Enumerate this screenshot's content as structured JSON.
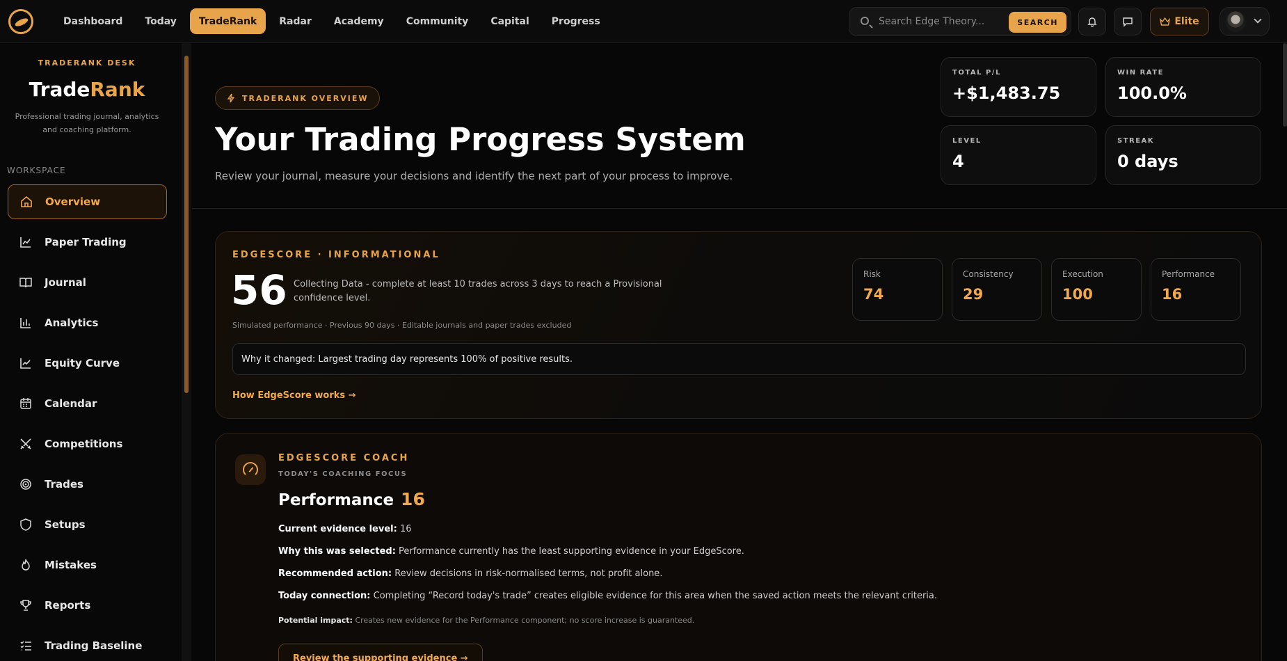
{
  "nav": {
    "items": [
      "Dashboard",
      "Today",
      "TradeRank",
      "Radar",
      "Academy",
      "Community",
      "Capital",
      "Progress"
    ],
    "active": "TradeRank"
  },
  "search": {
    "placeholder": "Search Edge Theory...",
    "button": "SEARCH"
  },
  "header": {
    "elite_label": "Elite"
  },
  "sidebar": {
    "desk_label": "TRADERANK DESK",
    "brand_a": "Trade",
    "brand_b": "Rank",
    "brand_sub": "Professional trading journal, analytics and coaching platform.",
    "workspace_label": "WORKSPACE",
    "items": [
      {
        "label": "Overview",
        "icon": "home-icon"
      },
      {
        "label": "Paper Trading",
        "icon": "chart-line-icon"
      },
      {
        "label": "Journal",
        "icon": "book-icon"
      },
      {
        "label": "Analytics",
        "icon": "bar-chart-icon"
      },
      {
        "label": "Equity Curve",
        "icon": "trend-icon"
      },
      {
        "label": "Calendar",
        "icon": "calendar-icon"
      },
      {
        "label": "Competitions",
        "icon": "swords-icon"
      },
      {
        "label": "Trades",
        "icon": "target-icon"
      },
      {
        "label": "Setups",
        "icon": "shield-icon"
      },
      {
        "label": "Mistakes",
        "icon": "flame-icon"
      },
      {
        "label": "Reports",
        "icon": "trophy-icon"
      },
      {
        "label": "Trading Baseline",
        "icon": "checklist-icon"
      }
    ]
  },
  "hero": {
    "pill": "TRADERANK OVERVIEW",
    "title": "Your Trading Progress System",
    "subtitle": "Review your journal, measure your decisions and identify the next part of your process to improve."
  },
  "stats": [
    {
      "label": "TOTAL P/L",
      "value": "+$1,483.75"
    },
    {
      "label": "WIN RATE",
      "value": "100.0%"
    },
    {
      "label": "LEVEL",
      "value": "4"
    },
    {
      "label": "STREAK",
      "value": "0 days"
    }
  ],
  "edgescore": {
    "label": "EDGESCORE · INFORMATIONAL",
    "score": "56",
    "description": "Collecting Data - complete at least 10 trades across 3 days to reach a Provisional confidence level.",
    "meta": "Simulated performance · Previous 90 days · Editable journals and paper trades excluded",
    "components": [
      {
        "label": "Risk",
        "value": "74"
      },
      {
        "label": "Consistency",
        "value": "29"
      },
      {
        "label": "Execution",
        "value": "100"
      },
      {
        "label": "Performance",
        "value": "16"
      }
    ],
    "why": "Why it changed: Largest trading day represents 100% of positive results.",
    "link": "How EdgeScore works"
  },
  "coach": {
    "label": "EDGESCORE COACH",
    "sub": "TODAY'S COACHING FOCUS",
    "title": "Performance",
    "title_num": "16",
    "lines": [
      {
        "k": "Current evidence level:",
        "v": "16"
      },
      {
        "k": "Why this was selected:",
        "v": "Performance currently has the least supporting evidence in your EdgeScore."
      },
      {
        "k": "Recommended action:",
        "v": "Review decisions in risk-normalised terms, not profit alone."
      },
      {
        "k": "Today connection:",
        "v": "Completing “Record today's trade” creates eligible evidence for this area when the saved action meets the relevant criteria."
      }
    ],
    "impact_k": "Potential impact:",
    "impact_v": "Creates new evidence for the Performance component; no score increase is guaranteed.",
    "button": "Review the supporting evidence"
  },
  "colors": {
    "accent": "#e8a44a",
    "bg": "#070707"
  }
}
